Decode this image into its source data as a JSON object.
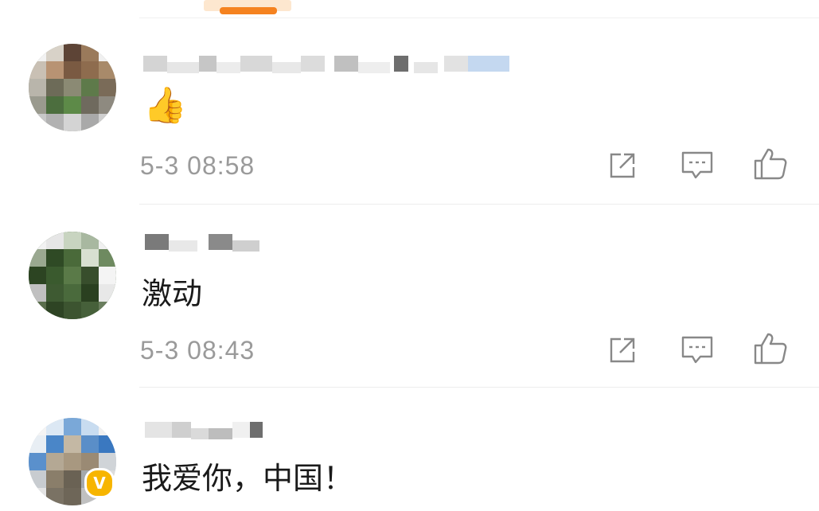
{
  "tabs": {
    "active_indicator_color": "#f5821f"
  },
  "comments": [
    {
      "username": "",
      "content_emoji": "👍",
      "content": "",
      "time": "5-3 08:58",
      "verified": false,
      "actions": [
        "share-icon",
        "comment-icon",
        "like-icon"
      ]
    },
    {
      "username": "",
      "content": "激动",
      "time": "5-3 08:43",
      "verified": false,
      "actions": [
        "share-icon",
        "comment-icon",
        "like-icon"
      ]
    },
    {
      "username": "",
      "content": "我爱你，中国！",
      "verified": true,
      "badge": "V"
    }
  ]
}
